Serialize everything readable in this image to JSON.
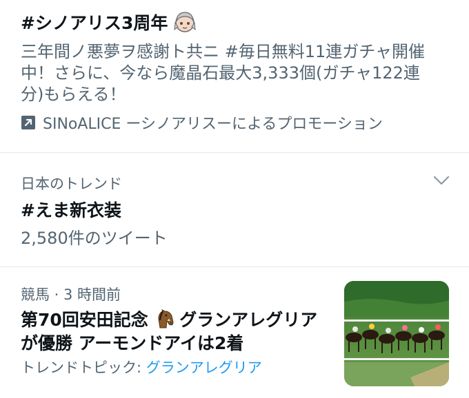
{
  "promo": {
    "title": "#シノアリス3周年",
    "body_lines": [
      "三年間ノ悪夢ヲ感謝ト共ニ #毎日無料11連ガチャ開催",
      "中！さらに、今なら魔晶石最大3,333個(ガチャ122連",
      "分)もらえる！"
    ],
    "promoted_by": "SINoALICE ーシノアリスーによるプロモーション"
  },
  "trend": {
    "context": "日本のトレンド",
    "name": "#えま新衣装",
    "tweet_count": "2,580件のツイート"
  },
  "story": {
    "meta": "競馬 · 3 時間前",
    "headline_part1": "第70回安田記念",
    "headline_part2": "グランアレグリア",
    "headline_line2": "が優勝 アーモンドアイは2着",
    "topic_label": "トレンドトピック: ",
    "topic_link": "グランアレグリア"
  },
  "colors": {
    "text_primary": "#0f1419",
    "text_secondary": "#536471",
    "link": "#1d9bf0",
    "divider": "#e1e8ed"
  },
  "icons": [
    "character-face-emoji",
    "promoted-arrow-icon",
    "chevron-down-icon",
    "horse-face-emoji",
    "horse-race-thumbnail"
  ]
}
